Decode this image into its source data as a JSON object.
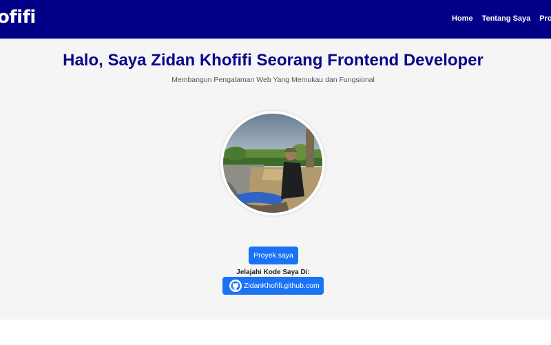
{
  "navbar": {
    "brand": "ofifi",
    "links": [
      "Home",
      "Tentang Saya",
      "Proyek"
    ]
  },
  "hero": {
    "title": "Halo, Saya Zidan Khofifi Seorang Frontend Developer",
    "subtitle": "Membangun Pengalaman Web Yang Memukau dan Fungsional",
    "projects_button": "Proyek saya",
    "explore_label": "Jelajahi Kode Saya Di:",
    "github_link": "ZidanKhofifi.github.com"
  },
  "colors": {
    "navbar_bg": "#020086",
    "title": "#08088a",
    "button": "#1a73f5",
    "hero_bg": "#f5f5f6"
  },
  "icons": [
    "github-icon"
  ]
}
